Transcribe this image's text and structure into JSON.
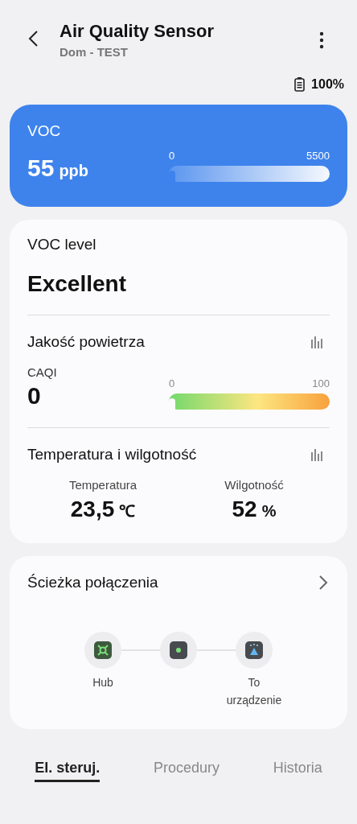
{
  "header": {
    "title": "Air Quality Sensor",
    "subtitle": "Dom - TEST"
  },
  "battery": {
    "text": "100%"
  },
  "voc_card": {
    "label": "VOC",
    "value": "55",
    "unit": "ppb",
    "min": "0",
    "max": "5500"
  },
  "details": {
    "voc_level_label": "VOC level",
    "voc_level_value": "Excellent",
    "air_quality": {
      "title": "Jakość powietrza",
      "label": "CAQI",
      "value": "0",
      "min": "0",
      "max": "100"
    },
    "climate": {
      "title": "Temperatura i wilgotność",
      "readings": [
        {
          "label": "Temperatura",
          "value": "23,5",
          "unit": "℃"
        },
        {
          "label": "Wilgotność",
          "value": "52",
          "unit": "%"
        }
      ]
    }
  },
  "connection": {
    "title": "Ścieżka połączenia",
    "nodes": [
      {
        "kind": "hub",
        "label": "Hub"
      },
      {
        "kind": "link"
      },
      {
        "kind": "device",
        "label": "To urządzenie"
      }
    ]
  },
  "tabs": [
    {
      "label": "El. steruj.",
      "selected": true
    },
    {
      "label": "Procedury",
      "selected": false
    },
    {
      "label": "Historia",
      "selected": false
    }
  ]
}
